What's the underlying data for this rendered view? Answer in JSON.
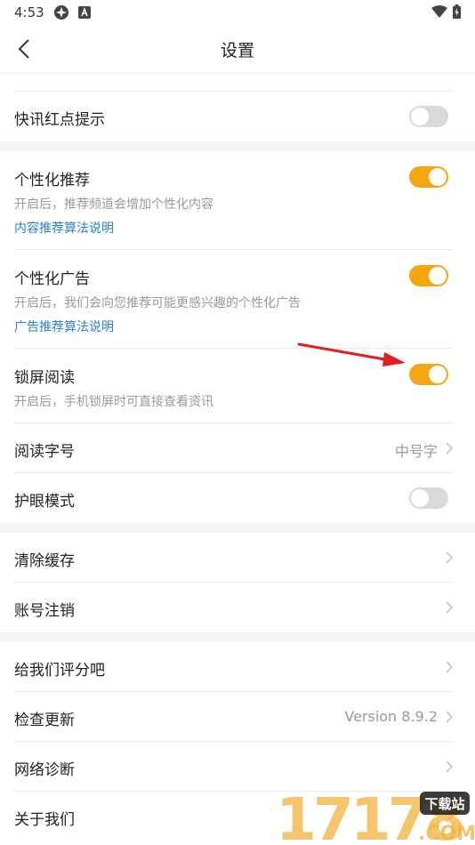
{
  "status_bar": {
    "time": "4:53"
  },
  "nav": {
    "title": "设置"
  },
  "settings": {
    "flash_red_dot": {
      "title": "快讯红点提示",
      "toggle": false
    },
    "personal_recommend": {
      "title": "个性化推荐",
      "subtitle": "开启后，推荐频道会增加个性化内容",
      "link": "内容推荐算法说明",
      "toggle": true
    },
    "personal_ads": {
      "title": "个性化广告",
      "subtitle": "开启后，我们会向您推荐可能更感兴趣的个性化广告",
      "link": "广告推荐算法说明",
      "toggle": true
    },
    "lock_screen": {
      "title": "锁屏阅读",
      "subtitle": "开启后，手机锁屏时可直接查看资讯",
      "toggle": true
    },
    "font_size": {
      "title": "阅读字号",
      "value": "中号字"
    },
    "eye_mode": {
      "title": "护眼模式",
      "toggle": false
    },
    "clear_cache": {
      "title": "清除缓存"
    },
    "account_cancel": {
      "title": "账号注销"
    },
    "rate_us": {
      "title": "给我们评分吧"
    },
    "check_update": {
      "title": "检查更新",
      "value": "Version 8.9.2"
    },
    "network_diag": {
      "title": "网络诊断"
    },
    "about_us": {
      "title": "关于我们"
    }
  },
  "watermark": {
    "text": "17178",
    "badge": "下载站",
    "domain": ".COM"
  },
  "colors": {
    "accent": "#f6a612",
    "link": "#2a7fd8",
    "toggle_off": "#d9d9d9",
    "arrow": "#e02020"
  }
}
